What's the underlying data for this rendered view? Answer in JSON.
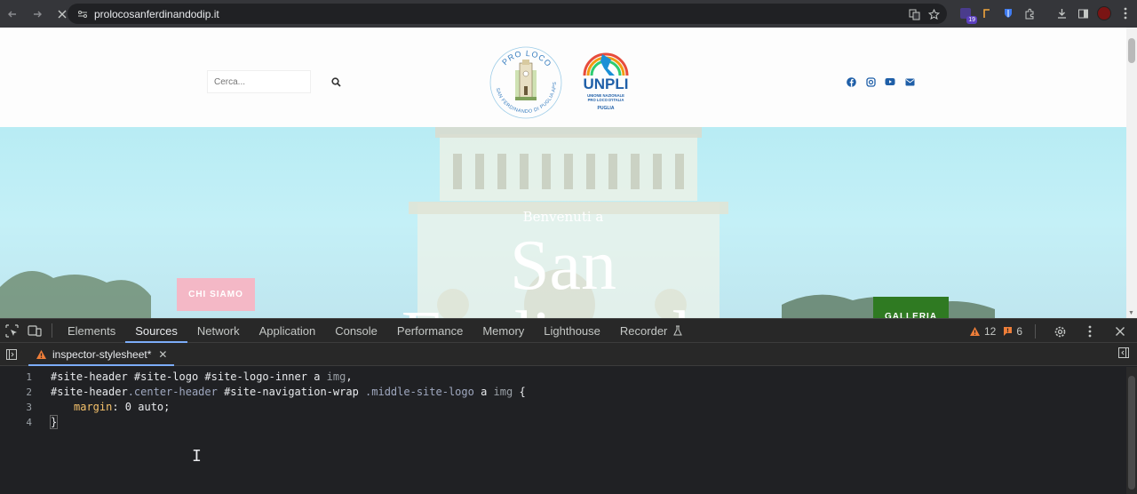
{
  "browser": {
    "url": "prolocosanferdinandodip.it",
    "extension_badge": "19"
  },
  "site": {
    "search_placeholder": "Cerca...",
    "logo_proloco": {
      "top_text": "PRO LOCO",
      "ring_text": "SAN FERDINANDO DI PUGLIA APS"
    },
    "logo_unpli": {
      "name": "UNPLI",
      "line1": "UNIONE NAZIONALE",
      "line2": "PRO LOCO D'ITALIA",
      "line3": "PUGLIA"
    },
    "hero": {
      "welcome": "Benvenuti a",
      "title_line1": "San",
      "title_line2": "Ferdinando"
    },
    "btn_chi_siamo": "CHI SIAMO",
    "btn_galleria": "GALLERIA",
    "colors": {
      "accent_blue": "#1f5fa8",
      "pink": "#f4b8c6",
      "green": "#2f7a22"
    }
  },
  "devtools": {
    "tabs": [
      "Elements",
      "Sources",
      "Network",
      "Application",
      "Console",
      "Performance",
      "Memory",
      "Lighthouse",
      "Recorder"
    ],
    "active_tab": "Sources",
    "warnings_count": "12",
    "issues_count": "6",
    "file_tab": "inspector-stylesheet*",
    "line_numbers": [
      "1",
      "2",
      "3",
      "4"
    ],
    "code": {
      "l1_a": "#site-header #site-logo #site-logo-inner a ",
      "l1_b": "img",
      "l1_c": ",",
      "l2_a": "#site-header",
      "l2_b": ".center-header",
      "l2_c": " #site-navigation-wrap ",
      "l2_d": ".middle-site-logo",
      "l2_e": " a ",
      "l2_f": "img",
      "l2_g": " {",
      "l3_prop": "margin",
      "l3_val": ": 0 auto;",
      "l4": "}"
    }
  }
}
